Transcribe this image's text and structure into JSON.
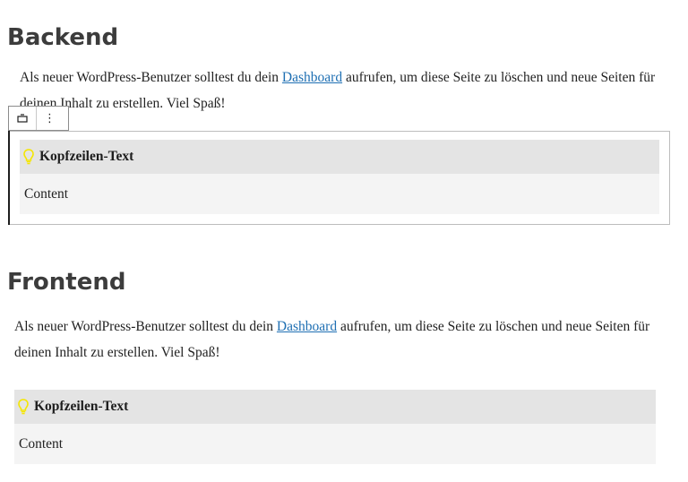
{
  "backend": {
    "heading": "Backend",
    "paragraph": {
      "before": "Als neuer WordPress-Benutzer solltest du dein ",
      "link": "Dashboard",
      "after": " aufrufen, um diese Seite zu löschen und neue Seiten für deinen Inhalt zu erstellen. Viel Spaß!"
    },
    "toolbar": {
      "block_type_icon": "block-icon",
      "options_icon": "more-vertical-icon",
      "options_glyph": "⋮"
    },
    "box": {
      "icon": "lightbulb-icon",
      "title": "Kopfzeilen-Text",
      "content": "Content"
    }
  },
  "frontend": {
    "heading": "Frontend",
    "paragraph": {
      "before": "Als neuer WordPress-Benutzer solltest du dein ",
      "link": "Dashboard",
      "after": " aufrufen, um diese Seite zu löschen und neue Seiten für deinen Inhalt zu erstellen. Viel Spaß!"
    },
    "box": {
      "icon": "lightbulb-icon",
      "title": "Kopfzeilen-Text",
      "content": "Content"
    }
  },
  "colors": {
    "heading": "#3c3c3c",
    "link": "#1e6fb3",
    "box_header_bg": "#e4e4e4",
    "box_content_bg": "#f4f4f4",
    "bulb": "#f5e600"
  }
}
